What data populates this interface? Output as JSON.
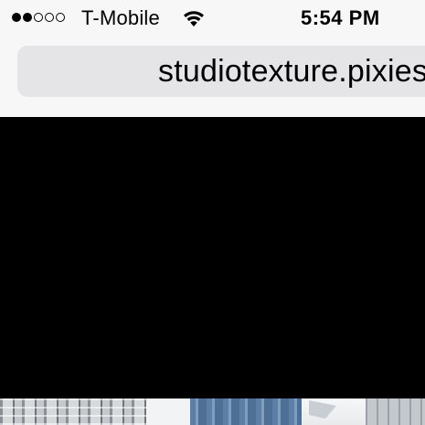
{
  "status_bar": {
    "signal_filled": 2,
    "signal_total": 5,
    "carrier": "T-Mobile",
    "wifi_icon": "wifi-icon",
    "time": "5:54 PM"
  },
  "address_bar": {
    "url": "studiotexture.pixies"
  },
  "content": {
    "video_background_color": "#000000",
    "photo_strip_icon": "building-photos"
  },
  "colors": {
    "chrome_background": "#f7f7f7",
    "url_field_background": "#e5e5e8"
  }
}
